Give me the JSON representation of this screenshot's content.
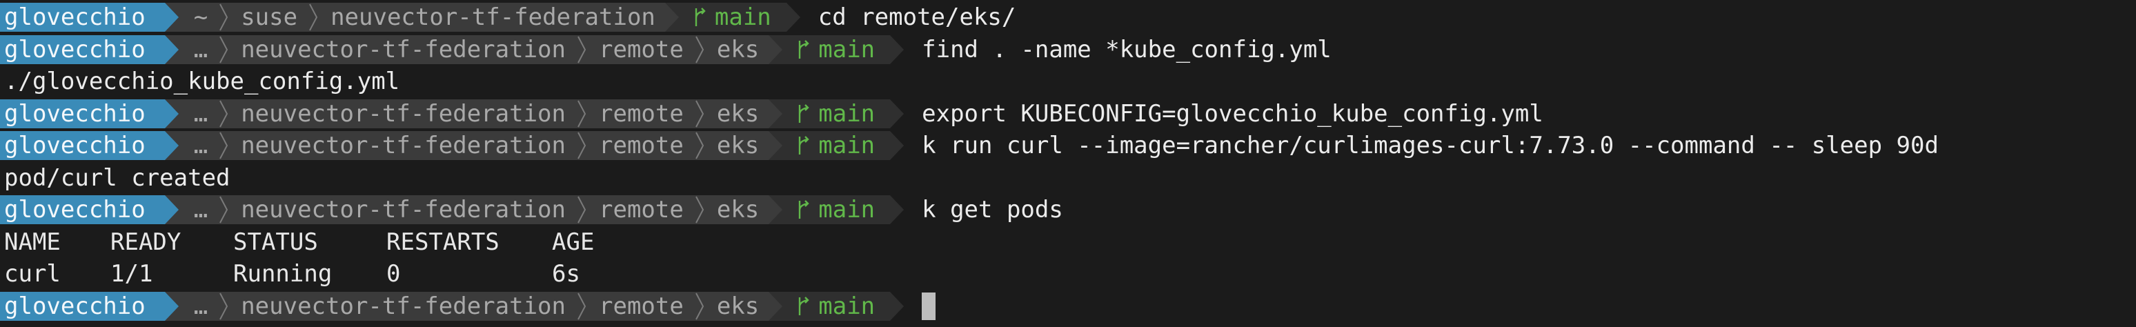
{
  "prompt": {
    "user": "glovecchio",
    "home_symbol": "~",
    "ellipsis": "…",
    "dir_suse": "suse",
    "dir_repo": "neuvector-tf-federation",
    "dir_remote": "remote",
    "dir_eks": "eks",
    "branch": "main"
  },
  "commands": [
    "cd remote/eks/",
    "find . -name *kube_config.yml",
    "export KUBECONFIG=glovecchio_kube_config.yml",
    "k run curl --image=rancher/curlimages-curl:7.73.0 --command -- sleep 90d",
    "k get pods"
  ],
  "outputs": {
    "find_result": "./glovecchio_kube_config.yml",
    "run_result": "pod/curl created"
  },
  "pods_table": {
    "headers": [
      "NAME",
      "READY",
      "STATUS",
      "RESTARTS",
      "AGE"
    ],
    "rows": [
      [
        "curl",
        "1/1",
        "Running",
        "0",
        "6s"
      ]
    ]
  },
  "colors": {
    "background": "#1b1b1b",
    "user_segment": "#3a8bb8",
    "dir_segment": "#3b3b3b",
    "git_segment": "#2f2f2f",
    "branch_text": "#61b84a"
  },
  "icons": [
    "branch-icon",
    "chevron-separator-icon",
    "cursor"
  ]
}
